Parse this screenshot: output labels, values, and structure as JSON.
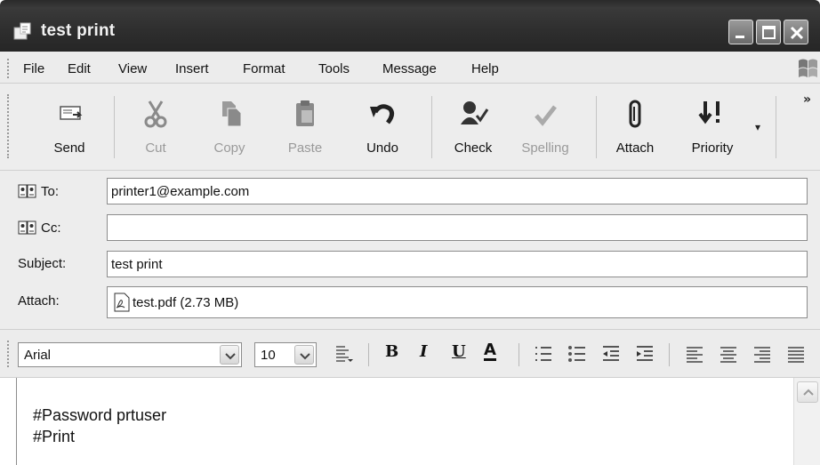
{
  "window": {
    "title": "test print"
  },
  "menu": [
    "File",
    "Edit",
    "View",
    "Insert",
    "Format",
    "Tools",
    "Message",
    "Help"
  ],
  "toolbar": {
    "send": "Send",
    "cut": "Cut",
    "copy": "Copy",
    "paste": "Paste",
    "undo": "Undo",
    "check": "Check",
    "spelling": "Spelling",
    "attach": "Attach",
    "priority": "Priority",
    "more": "»"
  },
  "headers": {
    "to_label": "To:",
    "to_value": "printer1@example.com",
    "cc_label": "Cc:",
    "cc_value": "",
    "subject_label": "Subject:",
    "subject_value": "test print",
    "attach_label": "Attach:",
    "attach_value": "test.pdf (2.73 MB)"
  },
  "format": {
    "font": "Arial",
    "size": "10",
    "bold": "B",
    "italic": "I",
    "underline": "U",
    "color": "A"
  },
  "body": {
    "line1": "#Password prtuser",
    "line2": "#Print"
  }
}
